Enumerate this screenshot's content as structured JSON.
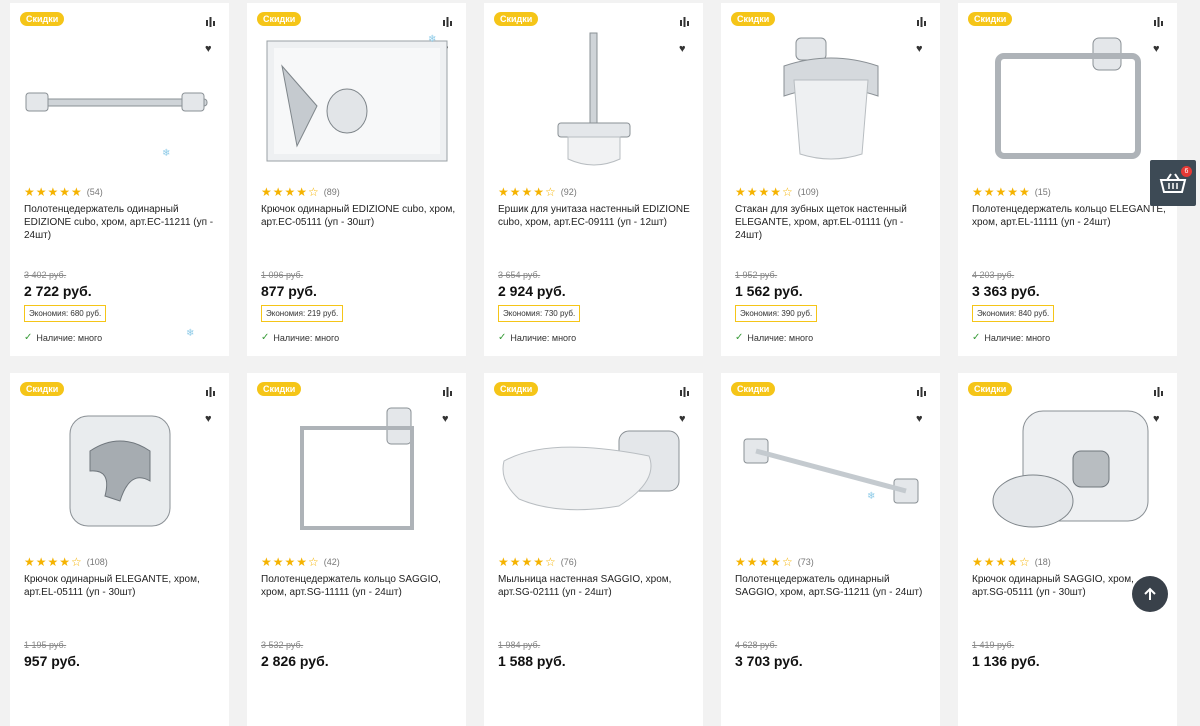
{
  "colors": {
    "badge": "#f5c518",
    "star": "#f5b301",
    "cart_bg": "#3d4a55",
    "cart_count_bg": "#e53935"
  },
  "cart": {
    "count": "6"
  },
  "products": [
    {
      "badge": "Скидки",
      "stars": 5,
      "reviews": "(54)",
      "title": "Полотенцедержатель одинарный EDIZIONE cubo, хром, арт.EC-11211 (уп - 24шт)",
      "old_price": "3 402 руб.",
      "price": "2 722 руб.",
      "saving": "Экономия: 680 руб.",
      "availability": "Наличие: много",
      "image": "towel-bar"
    },
    {
      "badge": "Скидки",
      "stars": 4,
      "reviews": "(89)",
      "title": "Крючок одинарный EDIZIONE cubo, хром, арт.EC-05111 (уп - 30шт)",
      "old_price": "1 096 руб.",
      "price": "877 руб.",
      "saving": "Экономия: 219 руб.",
      "availability": "Наличие: много",
      "image": "hook-square"
    },
    {
      "badge": "Скидки",
      "stars": 4,
      "reviews": "(92)",
      "title": "Ершик для унитаза настенный EDIZIONE cubo, хром, арт.EC-09111 (уп - 12шт)",
      "old_price": "3 654 руб.",
      "price": "2 924 руб.",
      "saving": "Экономия: 730 руб.",
      "availability": "Наличие: много",
      "image": "toilet-brush"
    },
    {
      "badge": "Скидки",
      "stars": 4,
      "reviews": "(109)",
      "title": "Стакан для зубных щеток настенный ELEGANTE, хром, арт.EL-01111 (уп - 24шт)",
      "old_price": "1 952 руб.",
      "price": "1 562 руб.",
      "saving": "Экономия: 390 руб.",
      "availability": "Наличие: много",
      "image": "cup"
    },
    {
      "badge": "Скидки",
      "stars": 5,
      "reviews": "(15)",
      "title": "Полотенцедержатель кольцо ELEGANTE, хром, арт.EL-11111 (уп - 24шт)",
      "old_price": "4 203 руб.",
      "price": "3 363 руб.",
      "saving": "Экономия: 840 руб.",
      "availability": "Наличие: много",
      "image": "towel-ring"
    },
    {
      "badge": "Скидки",
      "stars": 4,
      "reviews": "(108)",
      "title": "Крючок одинарный ELEGANTE, хром, арт.EL-05111 (уп - 30шт)",
      "old_price": "1 195 руб.",
      "price": "957 руб.",
      "image": "hook-rounded"
    },
    {
      "badge": "Скидки",
      "stars": 4,
      "reviews": "(42)",
      "title": "Полотенцедержатель кольцо SAGGIO, хром, арт.SG-11111 (уп - 24шт)",
      "old_price": "3 532 руб.",
      "price": "2 826 руб.",
      "image": "towel-ring-thin"
    },
    {
      "badge": "Скидки",
      "stars": 4,
      "reviews": "(76)",
      "title": "Мыльница настенная SAGGIO, хром, арт.SG-02111 (уп - 24шт)",
      "old_price": "1 984 руб.",
      "price": "1 588 руб.",
      "image": "soap-dish"
    },
    {
      "badge": "Скидки",
      "stars": 4,
      "reviews": "(73)",
      "title": "Полотенцедержатель одинарный SAGGIO, хром, арт.SG-11211 (уп - 24шт)",
      "old_price": "4 628 руб.",
      "price": "3 703 руб.",
      "image": "towel-bar-thin"
    },
    {
      "badge": "Скидки",
      "stars": 4,
      "reviews": "(18)",
      "title": "Крючок одинарный SAGGIO, хром, арт.SG-05111 (уп - 30шт)",
      "old_price": "1 419 руб.",
      "price": "1 136 руб.",
      "image": "hook-saggio"
    }
  ]
}
